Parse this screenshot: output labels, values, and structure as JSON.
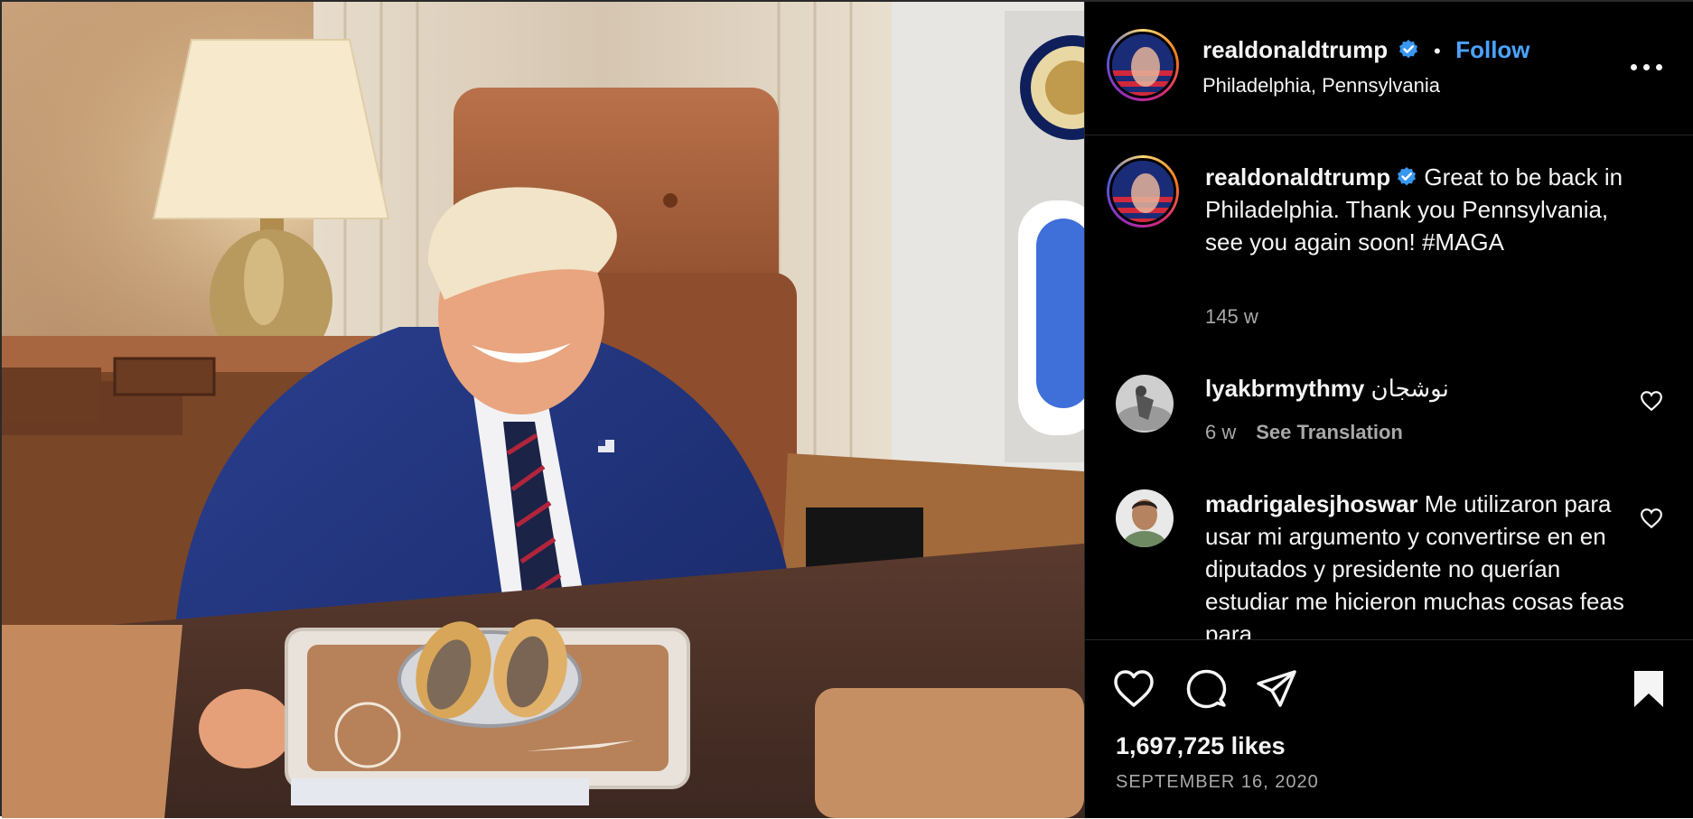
{
  "post": {
    "author": "realdonaldtrump",
    "location": "Philadelphia, Pennsylvania",
    "follow_label": "Follow",
    "separator": "•",
    "caption": "Great to be back in Philadelphia. Thank you Pennsylvania, see you again soon! #MAGA",
    "caption_age": "145 w"
  },
  "comments": [
    {
      "username": "lyakbrmythmy",
      "text": "نوشجان",
      "age": "6 w",
      "translate_label": "See Translation"
    },
    {
      "username": "madrigalesjhoswar",
      "text": "Me utilizaron para usar mi argumento y convertirse en en diputados y presidente no querían estudiar me hicieron muchas cosas feas para"
    }
  ],
  "engagement": {
    "likes": "1,697,725 likes",
    "date": "SEPTEMBER 16, 2020"
  },
  "icons": {
    "more": "more-options-icon",
    "like": "heart-icon",
    "comment": "comment-icon",
    "share": "share-icon",
    "save": "bookmark-icon",
    "verified": "verified-badge-icon"
  },
  "colors": {
    "background": "#000000",
    "link": "#4aa3ff",
    "muted": "#a8a8a8",
    "verified": "#3897f0"
  }
}
